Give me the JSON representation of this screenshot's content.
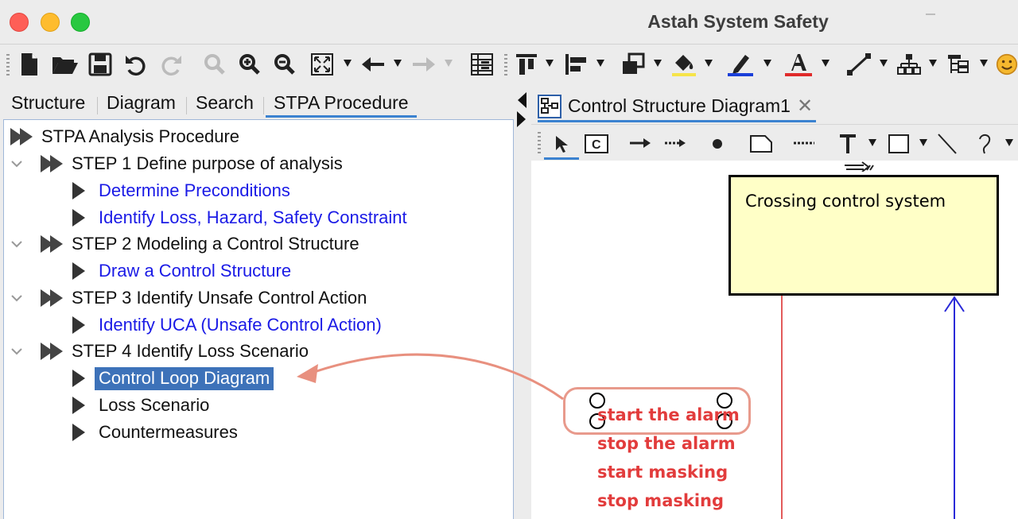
{
  "window": {
    "title": "Astah System Safety",
    "traffic_lights": [
      "close",
      "minimize",
      "maximize"
    ]
  },
  "toolbar": {
    "icons": [
      "new-file-icon",
      "open-folder-icon",
      "save-icon",
      "undo-icon",
      "redo-icon",
      "zoom-fit-icon",
      "zoom-in-icon",
      "zoom-out-icon",
      "expand-icon",
      "back-icon",
      "forward-icon",
      "table-icon",
      "align-top-icon",
      "align-left-icon",
      "layer-icon",
      "fill-color-icon",
      "line-color-icon",
      "font-color-icon",
      "line-style-icon",
      "tree-layout-icon",
      "list-layout-icon",
      "smiley-icon"
    ],
    "colors": {
      "fill": "#f6e44a",
      "line": "#1a3fd9",
      "font": "#e02b2b"
    }
  },
  "left_tabs": [
    {
      "label": "Structure"
    },
    {
      "label": "Diagram"
    },
    {
      "label": "Search"
    },
    {
      "label": "STPA Procedure",
      "active": true
    }
  ],
  "tree": {
    "root": "STPA Analysis Procedure",
    "steps": [
      {
        "label": "STEP 1 Define purpose of analysis",
        "items": [
          "Determine Preconditions",
          "Identify Loss, Hazard, Safety Constraint"
        ]
      },
      {
        "label": "STEP 2 Modeling a Control Structure",
        "items": [
          "Draw a Control Structure"
        ]
      },
      {
        "label": "STEP 3 Identify Unsafe Control Action",
        "items": [
          "Identify UCA (Unsafe Control Action)"
        ]
      },
      {
        "label": "STEP 4 Identify Loss Scenario",
        "items": [
          "Control Loop Diagram",
          "Loss Scenario",
          "Countermeasures"
        ]
      }
    ],
    "selected_item": "Control Loop Diagram"
  },
  "editor": {
    "tab_label": "Control Structure Diagram1",
    "diagram_tools": [
      "select-icon",
      "component-icon",
      "arrow-icon",
      "dotted-arrow-icon",
      "dot-icon",
      "note-icon",
      "dashed-line-icon",
      "text-icon",
      "rectangle-icon",
      "line-icon",
      "curve-icon"
    ],
    "controller_label": "Crossing control system",
    "control_actions": [
      "start the alarm",
      "stop the alarm",
      "start masking",
      "stop masking"
    ],
    "colors": {
      "controller_fill": "#ffffc7",
      "action_text": "#e23c3c",
      "feedback_line": "#2a2ad8",
      "control_line": "#e35b5b"
    }
  }
}
